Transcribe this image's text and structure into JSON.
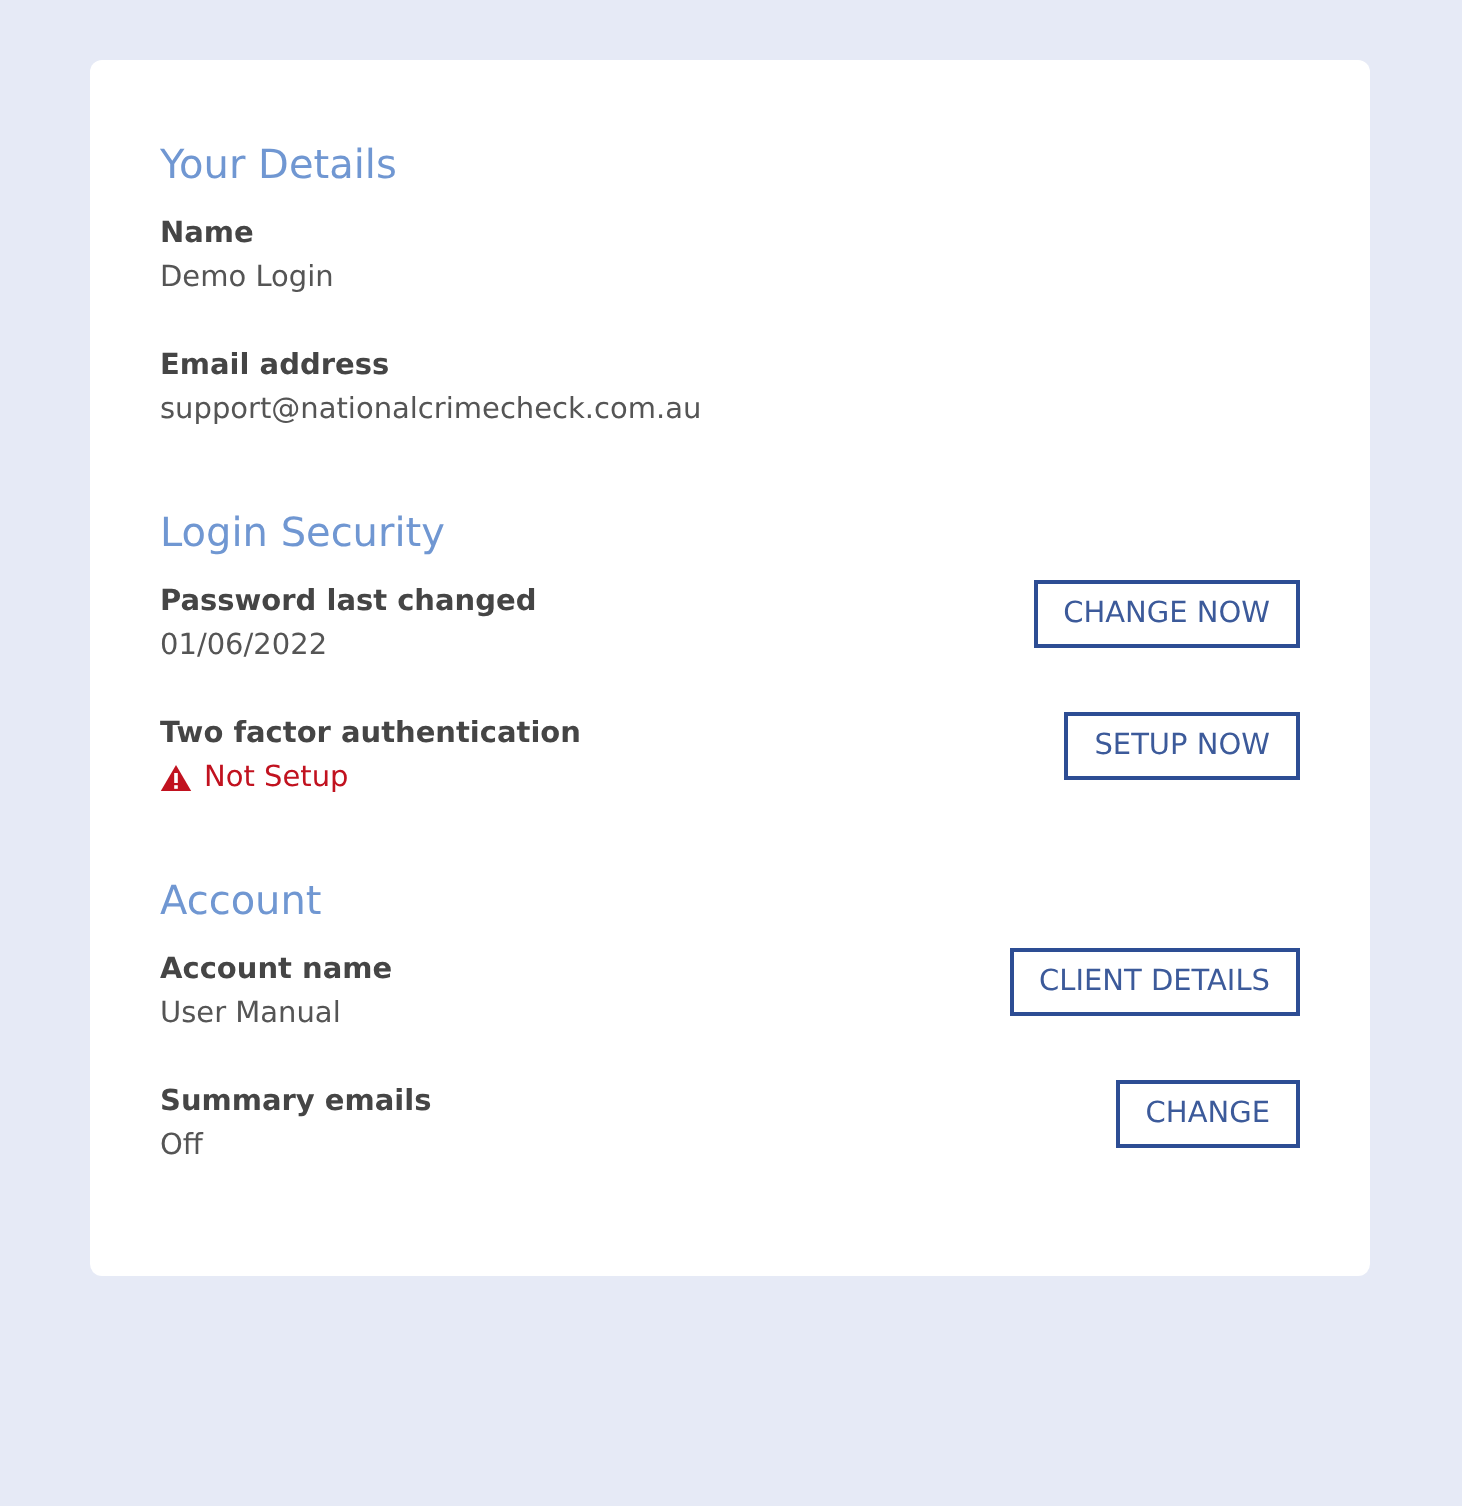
{
  "sections": [
    {
      "title": "Your Details",
      "fields": [
        {
          "label": "Name",
          "value": "Demo Login",
          "kind": "plain"
        },
        {
          "label": "Email address",
          "value": "support@nationalcrimecheck.com.au",
          "kind": "plain"
        }
      ]
    },
    {
      "title": "Login Security",
      "fields": [
        {
          "label": "Password last changed",
          "value": "01/06/2022",
          "kind": "plain",
          "button": "CHANGE NOW"
        },
        {
          "label": "Two factor authentication",
          "value": "Not Setup",
          "kind": "warning",
          "button": "SETUP NOW"
        }
      ]
    },
    {
      "title": "Account",
      "fields": [
        {
          "label": "Account name",
          "value": "User Manual",
          "kind": "plain",
          "button": "CLIENT DETAILS"
        },
        {
          "label": "Summary emails",
          "value": "Off",
          "kind": "plain",
          "button": "CHANGE"
        }
      ]
    }
  ]
}
